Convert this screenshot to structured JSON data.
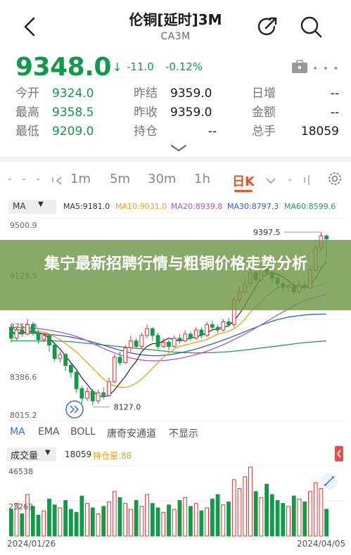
{
  "header": {
    "title": "伦铜[延时]3M",
    "subtitle": "CA3M"
  },
  "quote": {
    "price": "9348.0",
    "arrow": "↓",
    "change": "-11.0",
    "change_pct": "-0.12%",
    "more_dots": "• • •"
  },
  "stats": [
    {
      "label": "今开",
      "value": "9324.0"
    },
    {
      "label": "最高",
      "value": "9358.5"
    },
    {
      "label": "最低",
      "value": "9209.0"
    },
    {
      "label": "昨结",
      "value": "9359.0"
    },
    {
      "label": "昨收",
      "value": "9359.0"
    },
    {
      "label": "持仓",
      "value": "--"
    },
    {
      "label": "日增",
      "value": "--"
    },
    {
      "label": "金额",
      "value": "--"
    },
    {
      "label": "总手",
      "value": "18059"
    }
  ],
  "period_tabs": [
    "1m",
    "5m",
    "30m",
    "1h",
    "日K"
  ],
  "ma_legend": {
    "select": "MA",
    "items": [
      {
        "text": "MA5:9181.0",
        "color": "#333333"
      },
      {
        "text": "MA10:9031.0",
        "color": "#e8a317"
      },
      {
        "text": "MA20:8939.8",
        "color": "#b055c8"
      },
      {
        "text": "MA30:8797.3",
        "color": "#2f5fc8"
      },
      {
        "text": "MA60:8599.6",
        "color": "#2a9a5a"
      }
    ]
  },
  "chart_data": {
    "type": "candlestick",
    "y_ticks": [
      "9500.9",
      "9129.5",
      "8758.0",
      "8386.6",
      "8015.2"
    ],
    "annotations": {
      "high_label": "9397.5",
      "low_label": "8127.0"
    },
    "colors": {
      "up": "#e03131",
      "down": "#129a4a"
    },
    "candles": [
      {
        "o": 8700,
        "c": 8620,
        "h": 8720,
        "l": 8590
      },
      {
        "o": 8620,
        "c": 8680,
        "h": 8700,
        "l": 8600
      },
      {
        "o": 8680,
        "c": 8650,
        "h": 8720,
        "l": 8630
      },
      {
        "o": 8650,
        "c": 8720,
        "h": 8760,
        "l": 8640
      },
      {
        "o": 8720,
        "c": 8660,
        "h": 8740,
        "l": 8640
      },
      {
        "o": 8660,
        "c": 8610,
        "h": 8680,
        "l": 8580
      },
      {
        "o": 8610,
        "c": 8640,
        "h": 8660,
        "l": 8590
      },
      {
        "o": 8640,
        "c": 8570,
        "h": 8650,
        "l": 8520
      },
      {
        "o": 8570,
        "c": 8470,
        "h": 8590,
        "l": 8450
      },
      {
        "o": 8470,
        "c": 8500,
        "h": 8520,
        "l": 8440
      },
      {
        "o": 8500,
        "c": 8420,
        "h": 8510,
        "l": 8380
      },
      {
        "o": 8420,
        "c": 8370,
        "h": 8440,
        "l": 8330
      },
      {
        "o": 8370,
        "c": 8250,
        "h": 8380,
        "l": 8220
      },
      {
        "o": 8250,
        "c": 8180,
        "h": 8270,
        "l": 8140
      },
      {
        "o": 8180,
        "c": 8230,
        "h": 8260,
        "l": 8160
      },
      {
        "o": 8230,
        "c": 8160,
        "h": 8250,
        "l": 8127
      },
      {
        "o": 8160,
        "c": 8220,
        "h": 8240,
        "l": 8140
      },
      {
        "o": 8220,
        "c": 8200,
        "h": 8260,
        "l": 8170
      },
      {
        "o": 8200,
        "c": 8300,
        "h": 8330,
        "l": 8190
      },
      {
        "o": 8300,
        "c": 8480,
        "h": 8500,
        "l": 8290
      },
      {
        "o": 8480,
        "c": 8440,
        "h": 8520,
        "l": 8420
      },
      {
        "o": 8440,
        "c": 8550,
        "h": 8570,
        "l": 8430
      },
      {
        "o": 8550,
        "c": 8600,
        "h": 8640,
        "l": 8520
      },
      {
        "o": 8600,
        "c": 8560,
        "h": 8620,
        "l": 8540
      },
      {
        "o": 8560,
        "c": 8640,
        "h": 8660,
        "l": 8540
      },
      {
        "o": 8640,
        "c": 8690,
        "h": 8720,
        "l": 8620
      },
      {
        "o": 8690,
        "c": 8640,
        "h": 8700,
        "l": 8600
      },
      {
        "o": 8640,
        "c": 8560,
        "h": 8660,
        "l": 8540
      },
      {
        "o": 8560,
        "c": 8590,
        "h": 8620,
        "l": 8550
      },
      {
        "o": 8590,
        "c": 8560,
        "h": 8610,
        "l": 8530
      },
      {
        "o": 8560,
        "c": 8620,
        "h": 8640,
        "l": 8550
      },
      {
        "o": 8620,
        "c": 8600,
        "h": 8650,
        "l": 8580
      },
      {
        "o": 8600,
        "c": 8650,
        "h": 8680,
        "l": 8590
      },
      {
        "o": 8650,
        "c": 8620,
        "h": 8670,
        "l": 8600
      },
      {
        "o": 8620,
        "c": 8680,
        "h": 8700,
        "l": 8610
      },
      {
        "o": 8680,
        "c": 8640,
        "h": 8700,
        "l": 8620
      },
      {
        "o": 8640,
        "c": 8720,
        "h": 8740,
        "l": 8630
      },
      {
        "o": 8720,
        "c": 8700,
        "h": 8750,
        "l": 8680
      },
      {
        "o": 8700,
        "c": 8680,
        "h": 8720,
        "l": 8660
      },
      {
        "o": 8680,
        "c": 8740,
        "h": 8760,
        "l": 8670
      },
      {
        "o": 8740,
        "c": 8720,
        "h": 8770,
        "l": 8700
      },
      {
        "o": 8720,
        "c": 8900,
        "h": 8920,
        "l": 8700
      },
      {
        "o": 8900,
        "c": 8960,
        "h": 9000,
        "l": 8880
      },
      {
        "o": 8960,
        "c": 9020,
        "h": 9060,
        "l": 8940
      },
      {
        "o": 9020,
        "c": 9100,
        "h": 9140,
        "l": 9000
      },
      {
        "o": 9100,
        "c": 9050,
        "h": 9130,
        "l": 9020
      },
      {
        "o": 9050,
        "c": 9150,
        "h": 9180,
        "l": 9030
      },
      {
        "o": 9150,
        "c": 9100,
        "h": 9180,
        "l": 9080
      },
      {
        "o": 9100,
        "c": 9060,
        "h": 9120,
        "l": 9020
      },
      {
        "o": 9060,
        "c": 9020,
        "h": 9080,
        "l": 8980
      },
      {
        "o": 9020,
        "c": 8990,
        "h": 9040,
        "l": 8960
      },
      {
        "o": 8990,
        "c": 9000,
        "h": 9020,
        "l": 8960
      },
      {
        "o": 9000,
        "c": 8960,
        "h": 9030,
        "l": 8940
      },
      {
        "o": 8960,
        "c": 9010,
        "h": 9040,
        "l": 8940
      },
      {
        "o": 9010,
        "c": 8990,
        "h": 9040,
        "l": 8970
      },
      {
        "o": 8990,
        "c": 9120,
        "h": 9140,
        "l": 8980
      },
      {
        "o": 9120,
        "c": 9280,
        "h": 9300,
        "l": 9100
      },
      {
        "o": 9280,
        "c": 9370,
        "h": 9397.5,
        "l": 9260
      },
      {
        "o": 9370,
        "c": 9348,
        "h": 9380,
        "l": 9209
      }
    ],
    "ma5": [
      8660,
      8650,
      8660,
      8665,
      8670,
      8660,
      8650,
      8620,
      8580,
      8540,
      8490,
      8440,
      8390,
      8330,
      8280,
      8230,
      8200,
      8190,
      8200,
      8240,
      8290,
      8340,
      8400,
      8450,
      8520,
      8560,
      8580,
      8580,
      8600,
      8620,
      8610,
      8600,
      8610,
      8620,
      8630,
      8640,
      8660,
      8680,
      8690,
      8700,
      8710,
      8750,
      8800,
      8860,
      8930,
      9000,
      9060,
      9090,
      9100,
      9090,
      9070,
      9040,
      9010,
      8990,
      8990,
      9010,
      9060,
      9130,
      9181
    ],
    "ma10": [
      8690,
      8685,
      8680,
      8680,
      8675,
      8670,
      8665,
      8650,
      8630,
      8610,
      8580,
      8550,
      8520,
      8480,
      8440,
      8400,
      8360,
      8320,
      8290,
      8270,
      8260,
      8260,
      8270,
      8290,
      8320,
      8360,
      8400,
      8440,
      8480,
      8510,
      8540,
      8560,
      8570,
      8580,
      8590,
      8600,
      8610,
      8630,
      8650,
      8660,
      8670,
      8690,
      8720,
      8760,
      8810,
      8850,
      8890,
      8930,
      8960,
      8990,
      9000,
      9010,
      9010,
      9000,
      8990,
      8990,
      9000,
      9010,
      9031
    ],
    "ma20": [
      8700,
      8700,
      8698,
      8696,
      8694,
      8690,
      8685,
      8680,
      8672,
      8664,
      8655,
      8645,
      8632,
      8618,
      8600,
      8582,
      8563,
      8545,
      8528,
      8512,
      8498,
      8486,
      8475,
      8466,
      8460,
      8456,
      8454,
      8454,
      8456,
      8460,
      8466,
      8472,
      8480,
      8490,
      8500,
      8512,
      8525,
      8540,
      8556,
      8572,
      8590,
      8610,
      8630,
      8650,
      8672,
      8695,
      8718,
      8742,
      8766,
      8790,
      8812,
      8834,
      8856,
      8876,
      8894,
      8908,
      8920,
      8930,
      8939.8
    ],
    "ma30": [
      8660,
      8660,
      8660,
      8658,
      8656,
      8654,
      8652,
      8648,
      8644,
      8640,
      8634,
      8628,
      8620,
      8612,
      8602,
      8592,
      8580,
      8568,
      8556,
      8544,
      8532,
      8522,
      8512,
      8504,
      8498,
      8494,
      8492,
      8492,
      8494,
      8498,
      8504,
      8512,
      8520,
      8530,
      8540,
      8552,
      8565,
      8578,
      8592,
      8606,
      8620,
      8636,
      8652,
      8668,
      8684,
      8700,
      8716,
      8730,
      8744,
      8756,
      8766,
      8774,
      8780,
      8786,
      8790,
      8793,
      8795,
      8796,
      8797.3
    ],
    "ma60": [
      8600,
      8600,
      8600,
      8600,
      8600,
      8600,
      8600,
      8600,
      8600,
      8598,
      8596,
      8594,
      8590,
      8586,
      8582,
      8578,
      8574,
      8570,
      8566,
      8562,
      8558,
      8554,
      8550,
      8546,
      8542,
      8538,
      8534,
      8530,
      8526,
      8522,
      8518,
      8516,
      8514,
      8513,
      8512,
      8512,
      8513,
      8514,
      8516,
      8518,
      8521,
      8525,
      8529,
      8533,
      8538,
      8543,
      8548,
      8553,
      8558,
      8563,
      8568,
      8573,
      8578,
      8583,
      8587,
      8591,
      8594,
      8597,
      8599.6
    ]
  },
  "banner": {
    "text": "集宁最新招聘行情与粗铜价格走势分析"
  },
  "indicator_tabs": [
    "MA",
    "EMA",
    "BOLL",
    "唐奇安通道",
    "不显示"
  ],
  "volume": {
    "select": "成交量",
    "volume_text": "18059",
    "position_text": "持仓量:88",
    "y_ticks": [
      "46538",
      "23269"
    ],
    "values": [
      18000,
      22000,
      15000,
      28000,
      20000,
      14000,
      17000,
      25000,
      21000,
      19000,
      24000,
      18000,
      16000,
      27000,
      22000,
      19000,
      15000,
      20000,
      23000,
      30000,
      26000,
      22000,
      18000,
      24000,
      20000,
      28000,
      22000,
      19000,
      16000,
      21000,
      18000,
      24000,
      26000,
      20000,
      22000,
      17000,
      19000,
      25000,
      28000,
      21000,
      23000,
      38000,
      32000,
      40000,
      46538,
      30000,
      26000,
      35000,
      28000,
      24000,
      22000,
      20000,
      27000,
      25000,
      23000,
      30000,
      36000,
      32000,
      18059
    ],
    "start_date": "2024/01/26",
    "end_date": "2024/04/05"
  }
}
